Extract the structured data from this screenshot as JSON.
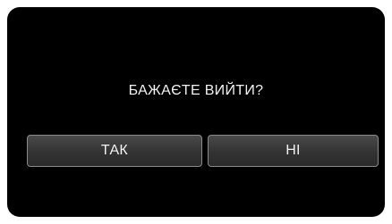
{
  "dialog": {
    "prompt": "БАЖАЄТЕ ВИЙТИ?",
    "yes_label": "ТАК",
    "no_label": "НІ"
  }
}
